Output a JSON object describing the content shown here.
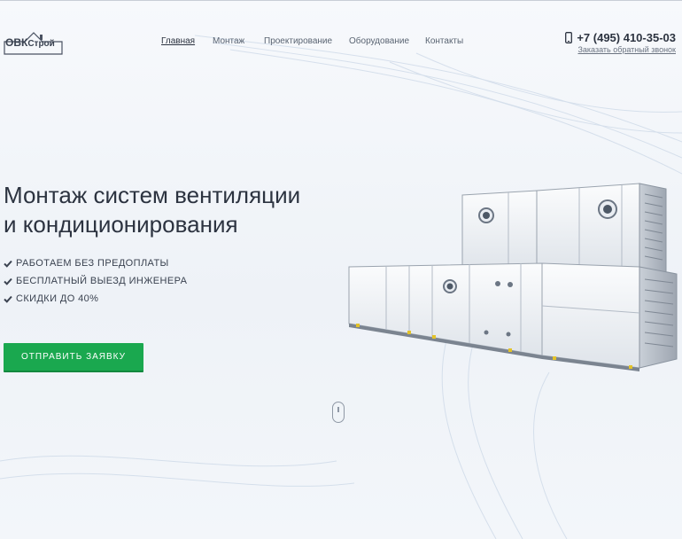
{
  "header": {
    "logo": {
      "text": "ОВК",
      "accent": "Строй"
    },
    "nav": [
      {
        "label": "Главная",
        "active": true
      },
      {
        "label": "Монтаж",
        "active": false
      },
      {
        "label": "Проектирование",
        "active": false
      },
      {
        "label": "Оборудование",
        "active": false
      },
      {
        "label": "Контакты",
        "active": false
      }
    ],
    "phone": "+7 (495) 410-35-03",
    "callback_link": "Заказать обратный звонок",
    "icons": {
      "phone": "mobile-phone-icon"
    }
  },
  "hero": {
    "title_line1": "Монтаж систем вентиляции",
    "title_line2": "и кондиционирования",
    "features": [
      "РАБОТАЕМ БЕЗ ПРЕДОПЛАТЫ",
      "БЕСПЛАТНЫЙ ВЫЕЗД ИНЖЕНЕРА",
      "СКИДКИ ДО 40%"
    ],
    "feature_icon": "check-icon",
    "cta_label": "ОТПРАВИТЬ ЗАЯВКУ",
    "image": "air-handling-unit-image"
  },
  "scroll_hint": {
    "icon": "mouse-scroll-icon"
  },
  "colors": {
    "accent": "#1aa84f",
    "text_dark": "#2c3340",
    "background": "#f3f6fa"
  }
}
